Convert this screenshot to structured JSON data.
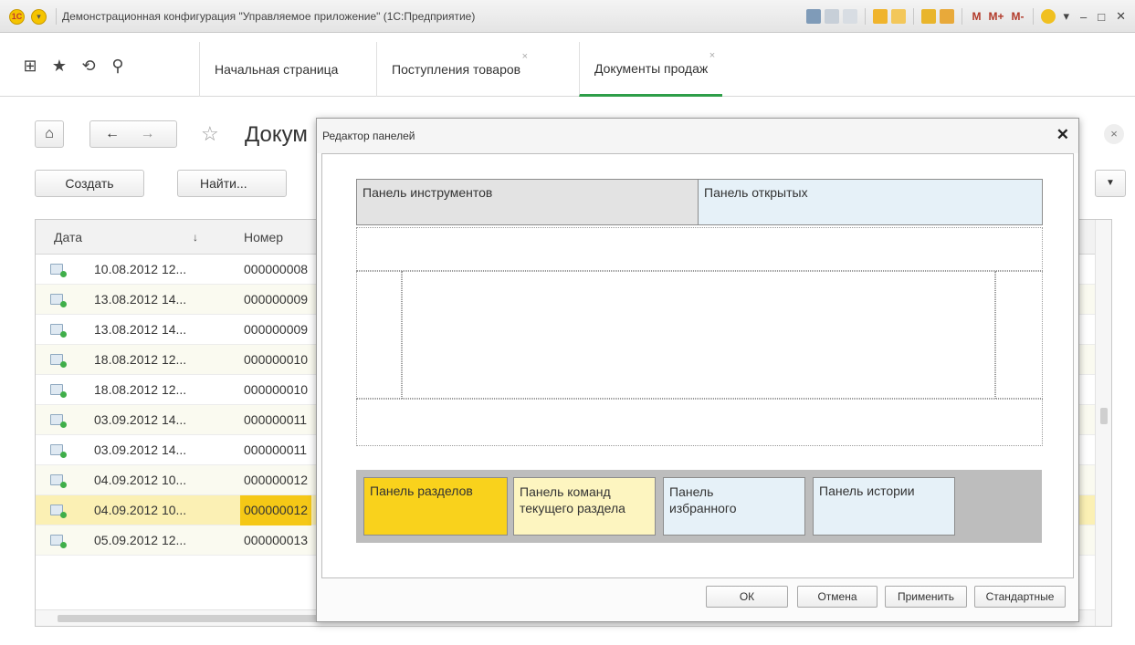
{
  "window": {
    "title": "Демонстрационная конфигурация \"Управляемое приложение\"  (1С:Предприятие)",
    "logo": "1С",
    "m_labels": [
      "M",
      "M+",
      "M-"
    ]
  },
  "tabs": [
    {
      "label": "Начальная страница"
    },
    {
      "label": "Поступления товаров",
      "close": "×"
    },
    {
      "label": "Документы продаж",
      "close": "×"
    }
  ],
  "form": {
    "title": "Докум",
    "close": "×",
    "buttons": {
      "create": "Создать",
      "find": "Найти..."
    },
    "more": "▼"
  },
  "table": {
    "columns": {
      "date": "Дата",
      "sort": "↓",
      "number": "Номер"
    },
    "rows": [
      {
        "date": "10.08.2012 12...",
        "number": "000000008"
      },
      {
        "date": "13.08.2012 14...",
        "number": "000000009"
      },
      {
        "date": "13.08.2012 14...",
        "number": "000000009"
      },
      {
        "date": "18.08.2012 12...",
        "number": "000000010"
      },
      {
        "date": "18.08.2012 12...",
        "number": "000000010"
      },
      {
        "date": "03.09.2012 14...",
        "number": "000000011"
      },
      {
        "date": "03.09.2012 14...",
        "number": "000000011"
      },
      {
        "date": "04.09.2012 10...",
        "number": "000000012"
      },
      {
        "date": "04.09.2012 10...",
        "number": "000000012",
        "selected": true
      },
      {
        "date": "05.09.2012 12...",
        "number": "000000013"
      }
    ]
  },
  "dialog": {
    "title": "Редактор панелей",
    "close": "✕",
    "panels": {
      "tools": "Панель инструментов",
      "open": "Панель открытых",
      "sections": "Панель разделов",
      "commands": "Панель команд текущего раздела",
      "favorites": "Панель избранного",
      "history": "Панель истории"
    },
    "buttons": {
      "ok": "ОК",
      "cancel": "Отмена",
      "apply": "Применить",
      "default": "Стандартные"
    }
  },
  "colors": {
    "accent_tab": "#2e9e49",
    "sections_panel": "#f9d21c",
    "commands_panel": "#fdf5c0",
    "blue_panel": "#e6f1f8",
    "gray_panel": "#e3e3e3"
  }
}
